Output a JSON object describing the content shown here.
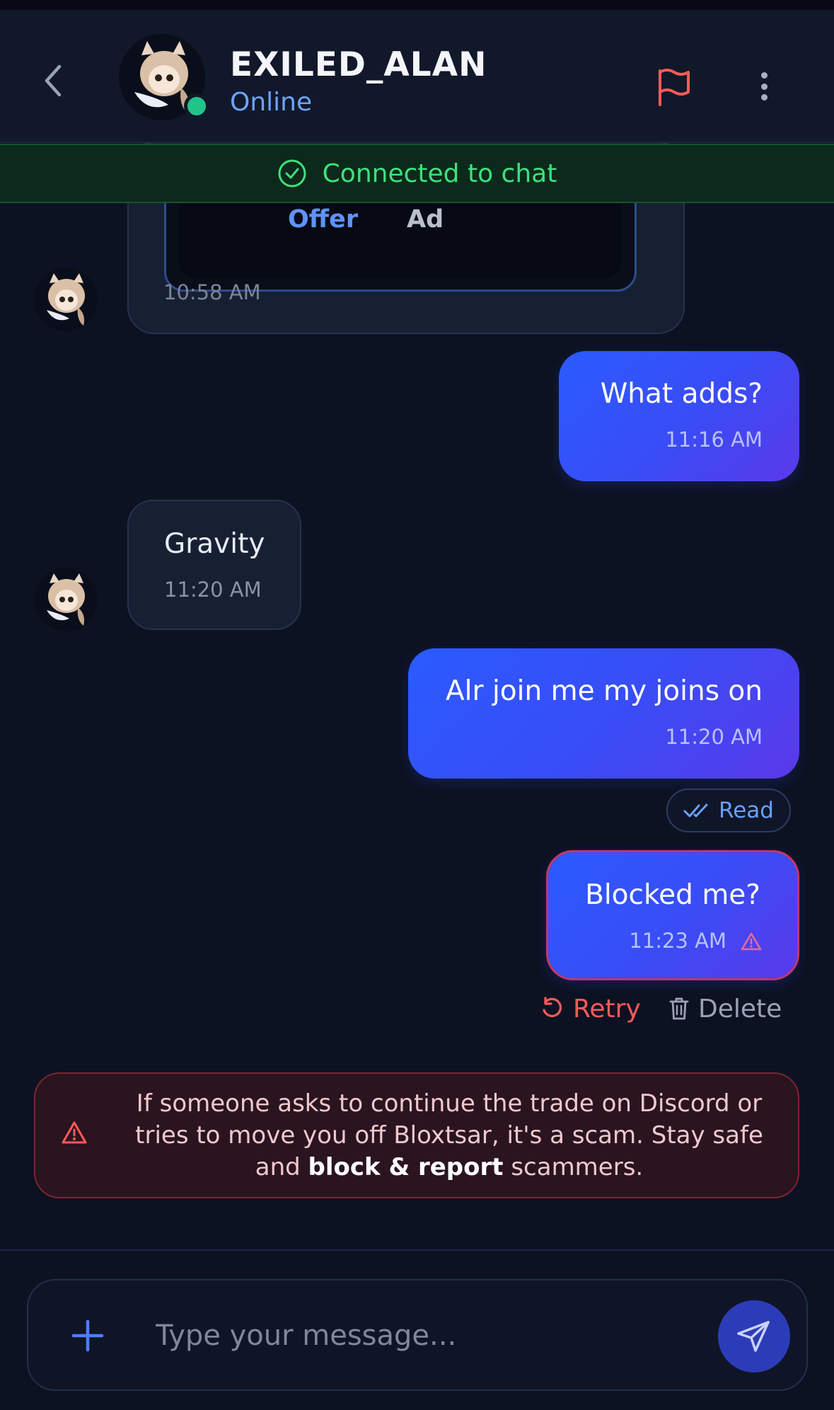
{
  "header": {
    "username": "EXILED_ALAN",
    "status": "Online"
  },
  "banner": {
    "text": "Connected to chat"
  },
  "offer_card": {
    "offer_label": "Offer",
    "ad_label": "Ad",
    "time": "10:58 AM"
  },
  "messages": [
    {
      "direction": "out",
      "text": "What adds?",
      "time": "11:16 AM"
    },
    {
      "direction": "in",
      "text": "Gravity",
      "time": "11:20 AM"
    },
    {
      "direction": "out",
      "text": "Alr join me my joins on",
      "time": "11:20 AM",
      "receipt": "Read"
    },
    {
      "direction": "out",
      "text": "Blocked me?",
      "time": "11:23 AM",
      "failed": true
    }
  ],
  "failed_actions": {
    "retry_label": "Retry",
    "delete_label": "Delete"
  },
  "warning": {
    "text_before": "If someone asks to continue the trade on Discord or tries to move you off Bloxtsar, it's a scam. Stay safe and ",
    "bold": "block & report",
    "text_after": " scammers."
  },
  "composer": {
    "placeholder": "Type your message..."
  },
  "colors": {
    "accent": "#2a5bff",
    "online": "#22c48a",
    "danger": "#ff5a5a",
    "connected": "#3ee07c"
  }
}
